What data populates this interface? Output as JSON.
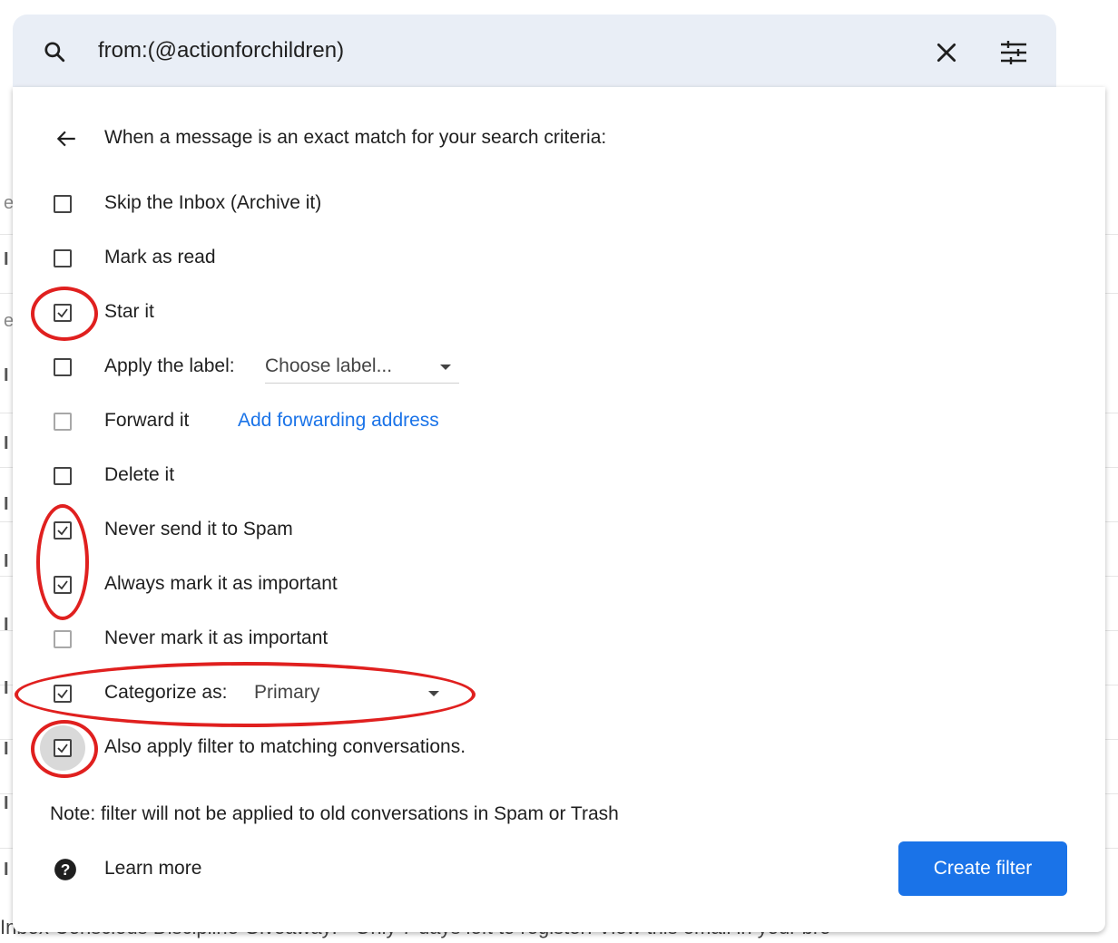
{
  "search": {
    "query": "from:(@actionforchildren)"
  },
  "filter_panel": {
    "header": "When a message is an exact match for your search criteria:",
    "options": [
      {
        "label": "Skip the Inbox (Archive it)",
        "checked": false
      },
      {
        "label": "Mark as read",
        "checked": false
      },
      {
        "label": "Star it",
        "checked": true
      },
      {
        "label": "Apply the label:",
        "checked": false
      },
      {
        "label": "Forward it",
        "checked": false,
        "disabled": true
      },
      {
        "label": "Delete it",
        "checked": false
      },
      {
        "label": "Never send it to Spam",
        "checked": true
      },
      {
        "label": "Always mark it as important",
        "checked": true
      },
      {
        "label": "Never mark it as important",
        "checked": false,
        "disabled": true
      },
      {
        "label": "Categorize as:",
        "checked": true
      },
      {
        "label": "Also apply filter to matching conversations.",
        "checked": true
      }
    ],
    "label_select": "Choose label...",
    "forward_link": "Add forwarding address",
    "category_select": "Primary",
    "note": "Note: filter will not be applied to old conversations in Spam or Trash",
    "learn_more": "Learn more",
    "create_button": "Create filter"
  },
  "background": {
    "bottom_row_text": "Inbox  Conscious Discipline Giveaway!  -  Only 7 days left to register! View this email in your bro"
  },
  "colors": {
    "accent": "#1a73e8",
    "annotation": "#e0201f",
    "search_bg": "#e9eef6"
  }
}
